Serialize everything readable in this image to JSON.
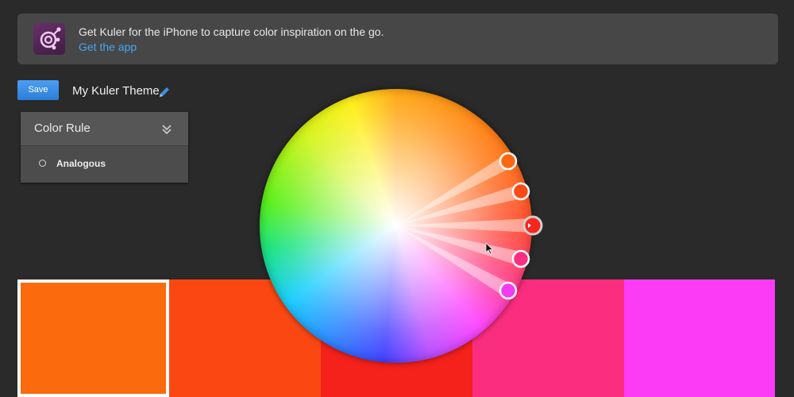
{
  "banner": {
    "message": "Get Kuler for the iPhone to capture color inspiration on the go.",
    "link": "Get the app",
    "icon": "kuler-app-icon"
  },
  "toolbar": {
    "save_label": "Save",
    "theme_name": "My Kuler Theme",
    "edit_icon": "pencil-icon"
  },
  "color_rule": {
    "title": "Color Rule",
    "selected": "Analogous"
  },
  "swatches": [
    {
      "color": "#fb6a0d",
      "selected": true
    },
    {
      "color": "#fb4812",
      "selected": false
    },
    {
      "color": "#f5211b",
      "selected": false
    },
    {
      "color": "#fb2d7e",
      "selected": false
    },
    {
      "color": "#fb3bf6",
      "selected": false
    }
  ],
  "wheel_markers": [
    {
      "color": "#fc6812",
      "base": false
    },
    {
      "color": "#fc4a16",
      "base": false
    },
    {
      "color": "#f8251d",
      "base": true
    },
    {
      "color": "#fb2e80",
      "base": false
    },
    {
      "color": "#f33bf2",
      "base": false
    }
  ]
}
